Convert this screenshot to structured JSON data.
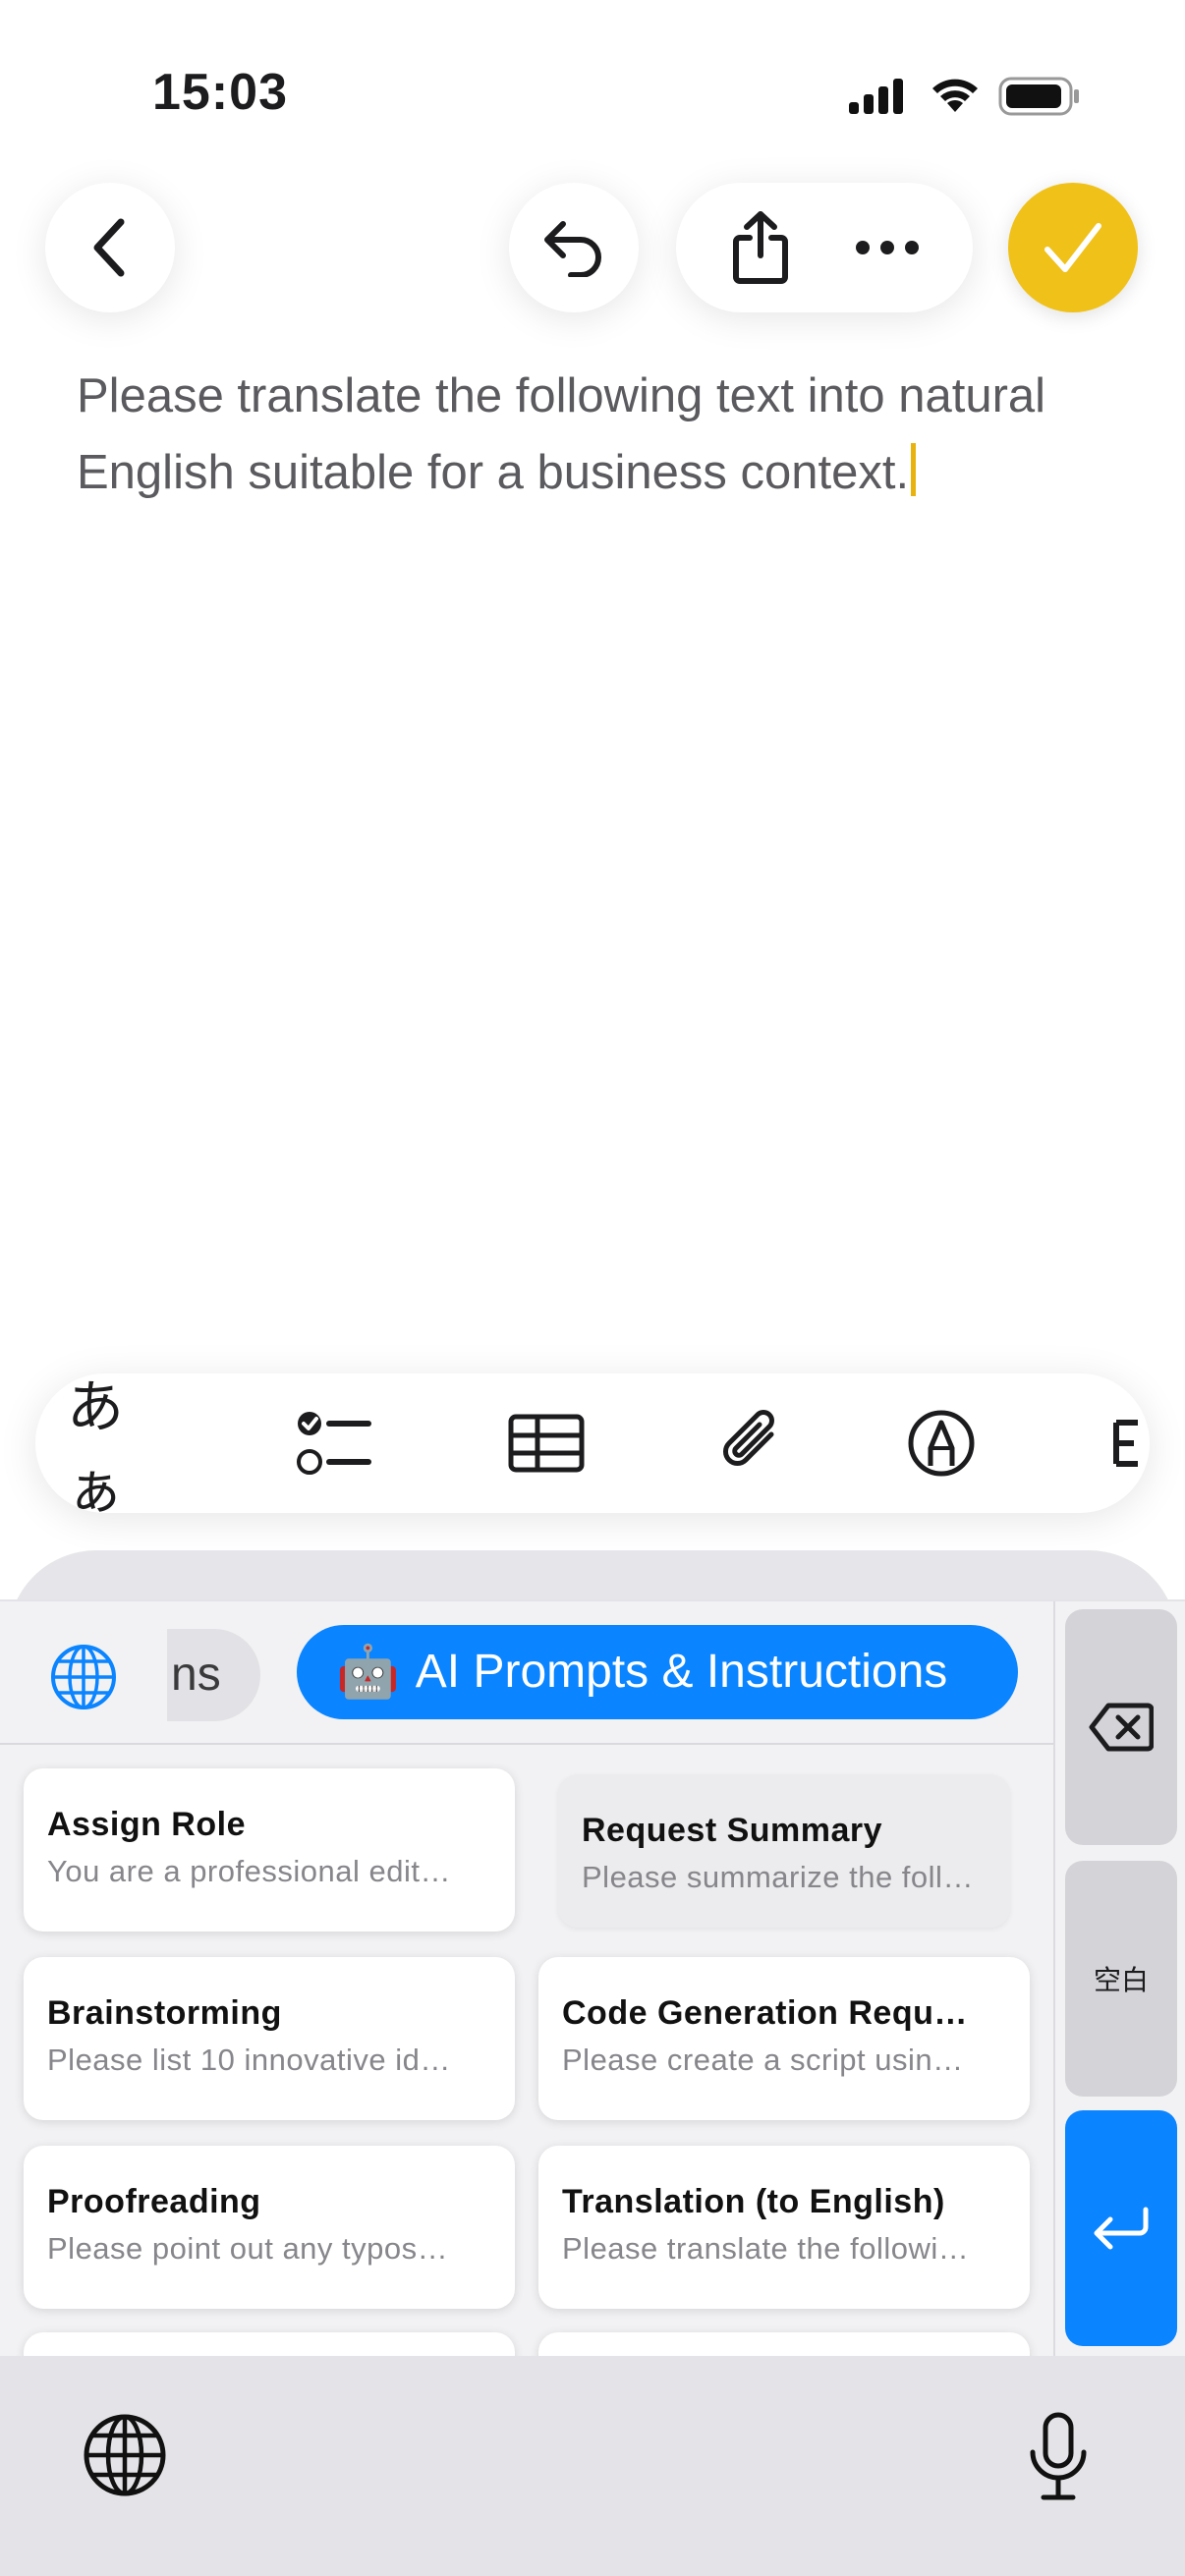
{
  "status_bar": {
    "time": "15:03"
  },
  "note": {
    "text": "Please translate the following text into natural English suitable for a business context."
  },
  "format_toolbar": {
    "text_style_label": "あぁ",
    "items": [
      "text-style",
      "checklist",
      "table",
      "attachment",
      "markup",
      "more"
    ]
  },
  "keyboard": {
    "category_partial": "ns",
    "category_active": {
      "emoji": "🤖",
      "label": "AI Prompts & Instructions"
    },
    "space_key_label": "空白",
    "accent_color": "#0a84ff",
    "prompts": [
      {
        "title": "Assign Role",
        "subtitle": "You are a professional edit…"
      },
      {
        "title": "Request Summary",
        "subtitle": "Please summarize the follo…"
      },
      {
        "title": "Brainstorming",
        "subtitle": "Please list 10 innovative id…"
      },
      {
        "title": "Code Generation Requ…",
        "subtitle": "Please create a script usin…"
      },
      {
        "title": "Proofreading",
        "subtitle": "Please point out any typos…"
      },
      {
        "title": "Translation (to English)",
        "subtitle": "Please translate the followi…"
      }
    ]
  },
  "done_button_color": "#f0c118"
}
